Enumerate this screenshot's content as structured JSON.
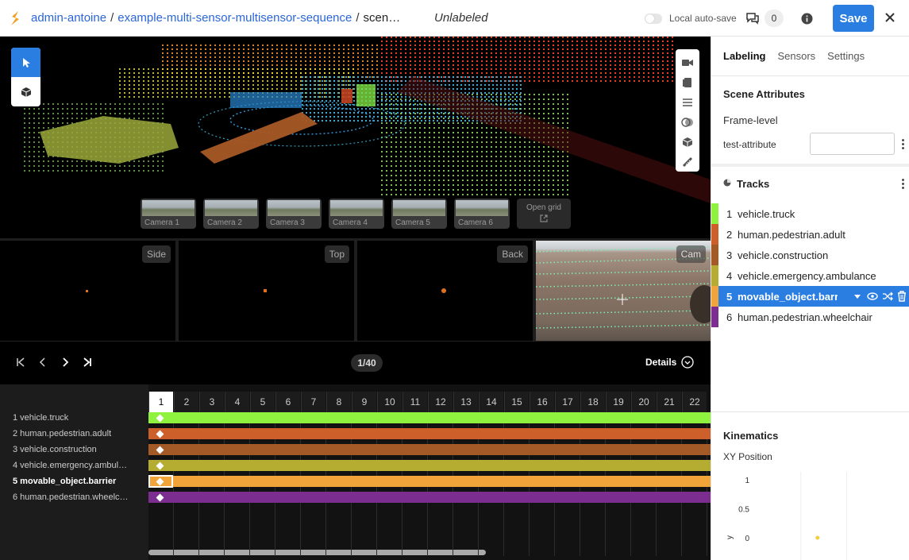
{
  "header": {
    "breadcrumb": [
      "admin-antoine",
      "example-multi-sensor-multisensor-sequence",
      "scen…"
    ],
    "status": "Unlabeled",
    "autosave_label": "Local auto-save",
    "comment_count": "0",
    "save_label": "Save"
  },
  "viewport": {
    "cameras": [
      "Camera 1",
      "Camera 2",
      "Camera 3",
      "Camera 4",
      "Camera 5",
      "Camera 6"
    ],
    "open_grid_label": "Open grid"
  },
  "views": {
    "side": "Side",
    "top": "Top",
    "back": "Back",
    "cam": "Cam"
  },
  "controls": {
    "frame_counter": "1/40",
    "details_label": "Details"
  },
  "timeline": {
    "frames": [
      "1",
      "2",
      "3",
      "4",
      "5",
      "6",
      "7",
      "8",
      "9",
      "10",
      "11",
      "12",
      "13",
      "14",
      "15",
      "16",
      "17",
      "18",
      "19",
      "20",
      "21",
      "22"
    ],
    "selected_frame": "1",
    "tracks": [
      {
        "label": "1 vehicle.truck",
        "color": "#8ef23e"
      },
      {
        "label": "2 human.pedestrian.adult",
        "color": "#cc5f2a"
      },
      {
        "label": "3 vehicle.construction",
        "color": "#a35a26"
      },
      {
        "label": "4 vehicle.emergency.ambul…",
        "color": "#b5ad32"
      },
      {
        "label": "5 movable_object.barrier",
        "color": "#f0a43a"
      },
      {
        "label": "6 human.pedestrian.wheelc…",
        "color": "#7b2e8f"
      }
    ],
    "scroll_fraction": 0.6
  },
  "sidebar": {
    "tabs": [
      "Labeling",
      "Sensors",
      "Settings"
    ],
    "active_tab": "Labeling",
    "scene_attributes_title": "Scene Attributes",
    "frame_level_label": "Frame-level",
    "attribute_name": "test-attribute",
    "tracks_title": "Tracks",
    "tracks": [
      {
        "num": "1",
        "name": "vehicle.truck",
        "color": "#8ef23e"
      },
      {
        "num": "2",
        "name": "human.pedestrian.adult",
        "color": "#cc5f2a"
      },
      {
        "num": "3",
        "name": "vehicle.construction",
        "color": "#a35a26"
      },
      {
        "num": "4",
        "name": "vehicle.emergency.ambulance",
        "color": "#b5ad32"
      },
      {
        "num": "5",
        "name": "movable_object.barrier",
        "color": "#f0a43a"
      },
      {
        "num": "6",
        "name": "human.pedestrian.wheelchair",
        "color": "#7b2e8f"
      }
    ],
    "selected_track": "5",
    "kinematics_title": "Kinematics",
    "xy_label": "XY Position"
  },
  "chart_data": {
    "type": "scatter",
    "title": "XY Position",
    "ylabel": "y",
    "y_ticks": [
      "1",
      "0.5",
      "0"
    ],
    "points": [
      {
        "x": 0,
        "y": 0
      }
    ],
    "point_color": "#f0d040"
  }
}
